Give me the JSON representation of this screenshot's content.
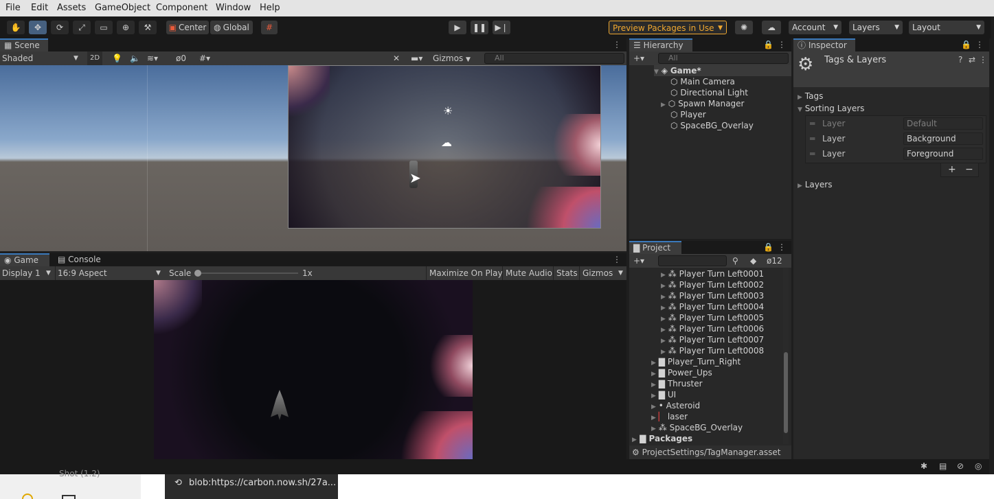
{
  "menubar": {
    "items": [
      "File",
      "Edit",
      "Assets",
      "GameObject",
      "Component",
      "Window",
      "Help"
    ]
  },
  "toolbar": {
    "pivot_label": "Center",
    "space_label": "Global",
    "preview_packages_label": "Preview Packages in Use",
    "account_label": "Account",
    "layers_label": "Layers",
    "layout_label": "Layout"
  },
  "scene": {
    "tab_label": "Scene",
    "shading_mode": "Shaded",
    "mode_2d_label": "2D",
    "hidden_count": "0",
    "gizmos_label": "Gizmos",
    "search_placeholder": "All"
  },
  "game": {
    "tab_label": "Game",
    "console_tab_label": "Console",
    "display_label": "Display 1",
    "aspect_label": "16:9 Aspect",
    "scale_label": "Scale",
    "scale_value": "1x",
    "scale_level": 0,
    "maximize_label": "Maximize On Play",
    "mute_label": "Mute Audio",
    "stats_label": "Stats",
    "gizmos_label": "Gizmos"
  },
  "hierarchy": {
    "tab_label": "Hierarchy",
    "search_placeholder": "All",
    "scene_name": "Game*",
    "items": [
      "Main Camera",
      "Directional Light",
      "Spawn Manager",
      "Player",
      "SpaceBG_Overlay"
    ]
  },
  "project": {
    "tab_label": "Project",
    "hidden_count": "12",
    "items": [
      "Player Turn Left0001",
      "Player Turn Left0002",
      "Player Turn Left0003",
      "Player Turn Left0004",
      "Player Turn Left0005",
      "Player Turn Left0006",
      "Player Turn Left0007",
      "Player Turn Left0008"
    ],
    "folders": [
      "Player_Turn_Right",
      "Power_Ups",
      "Thruster",
      "UI"
    ],
    "assets": [
      "Asteroid",
      "laser",
      "SpaceBG_Overlay"
    ],
    "packages_label": "Packages",
    "footer_path": "ProjectSettings/TagManager.asset"
  },
  "inspector": {
    "tab_label": "Inspector",
    "title": "Tags & Layers",
    "tags_label": "Tags",
    "sorting_layers_label": "Sorting Layers",
    "sorting_layers": [
      {
        "label": "Layer",
        "value": "Default"
      },
      {
        "label": "Layer",
        "value": "Background"
      },
      {
        "label": "Layer",
        "value": "Foreground"
      }
    ],
    "layers_label": "Layers",
    "add_label": "+",
    "remove_label": "−"
  },
  "taskbar": {
    "partial_label": "Shot (1.2)",
    "tooltip_text": "blob:https://carbon.now.sh/27a..."
  },
  "colors": {
    "accent": "#3a79bb",
    "preview_packages": "#f0a830",
    "menubar_bg": "#e4e4e4"
  }
}
